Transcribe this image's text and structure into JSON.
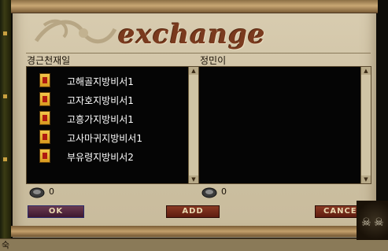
{
  "window": {
    "title": "exchange"
  },
  "left_panel": {
    "owner_name": "경근천재일",
    "items": [
      {
        "label": "고해골지방비서1",
        "icon": "scroll-badge-icon"
      },
      {
        "label": "고자호지방비서1",
        "icon": "scroll-badge-icon"
      },
      {
        "label": "고흥가지방비서1",
        "icon": "scroll-badge-icon"
      },
      {
        "label": "고사마귀지방비서1",
        "icon": "scroll-badge-icon"
      },
      {
        "label": "부유령지방비서2",
        "icon": "scroll-badge-icon"
      }
    ],
    "money": "0"
  },
  "right_panel": {
    "owner_name": "정민이",
    "items": [],
    "money": "0"
  },
  "buttons": {
    "ok": "OK",
    "add": "ADD",
    "cancel": "CANCEL"
  },
  "side": {
    "corner_text": "숙"
  },
  "colors": {
    "panel_bg": "#d3c7aa",
    "list_bg": "#050505",
    "title_color": "#7a3a1e",
    "button_color": "#7a2a18"
  }
}
